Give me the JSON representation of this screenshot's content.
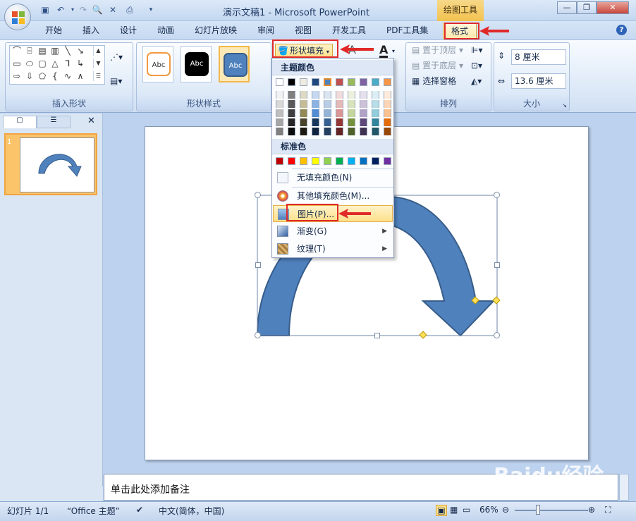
{
  "app": {
    "title": "演示文稿1 - Microsoft PowerPoint",
    "contextual_tab": "绘图工具"
  },
  "tabs": [
    "开始",
    "插入",
    "设计",
    "动画",
    "幻灯片放映",
    "审阅",
    "视图",
    "开发工具",
    "PDF工具集",
    "格式"
  ],
  "ribbon": {
    "groups": {
      "insert_shapes": "插入形状",
      "shape_styles": "形状样式",
      "arrange": "排列",
      "size": "大小"
    },
    "style_thumbs": [
      "Abc",
      "Abc",
      "Abc"
    ],
    "shape_fill": "形状填充",
    "arrange_items": [
      "置于顶层",
      "置于底层",
      "选择窗格"
    ],
    "height": "8 厘米",
    "width": "13.6 厘米"
  },
  "fill_menu": {
    "theme_colors_header": "主题颜色",
    "standard_colors_header": "标准色",
    "items": [
      "无填充颜色(N)",
      "其他填充颜色(M)...",
      "图片(P)...",
      "渐变(G)",
      "纹理(T)"
    ],
    "theme_top": [
      "#ffffff",
      "#000000",
      "#eeece1",
      "#1f497d",
      "#4f81bd",
      "#c0504d",
      "#9bbb59",
      "#8064a2",
      "#4bacc6",
      "#f79646"
    ],
    "theme_shades": [
      [
        "#f2f2f2",
        "#d8d8d8",
        "#bfbfbf",
        "#a5a5a5",
        "#7f7f7f"
      ],
      [
        "#7f7f7f",
        "#595959",
        "#3f3f3f",
        "#262626",
        "#0c0c0c"
      ],
      [
        "#ddd9c3",
        "#c4bd97",
        "#938953",
        "#494429",
        "#1d1b10"
      ],
      [
        "#c6d9f0",
        "#8db3e2",
        "#548dd4",
        "#17365d",
        "#0f243e"
      ],
      [
        "#dbe5f1",
        "#b8cce4",
        "#95b3d7",
        "#366092",
        "#244061"
      ],
      [
        "#f2dcdb",
        "#e5b9b7",
        "#d99694",
        "#953734",
        "#632423"
      ],
      [
        "#ebf1dd",
        "#d7e3bc",
        "#c3d69b",
        "#76923c",
        "#4f6128"
      ],
      [
        "#e5e0ec",
        "#ccc1d9",
        "#b2a2c7",
        "#5f497a",
        "#3f3151"
      ],
      [
        "#dbeef3",
        "#b7dde8",
        "#92cddc",
        "#31859b",
        "#205867"
      ],
      [
        "#fdeada",
        "#fbd5b5",
        "#fac08f",
        "#e36c09",
        "#974806"
      ]
    ],
    "standard": [
      "#c00000",
      "#ff0000",
      "#ffc000",
      "#ffff00",
      "#92d050",
      "#00b050",
      "#00b0f0",
      "#0070c0",
      "#002060",
      "#7030a0"
    ]
  },
  "slide_panel": {
    "slide_number": "1"
  },
  "notes_placeholder": "单击此处添加备注",
  "status": {
    "slide": "幻灯片 1/1",
    "theme": "“Office 主题”",
    "language": "中文(简体，中国)",
    "zoom": "66%"
  },
  "watermark": "Baidu经验"
}
